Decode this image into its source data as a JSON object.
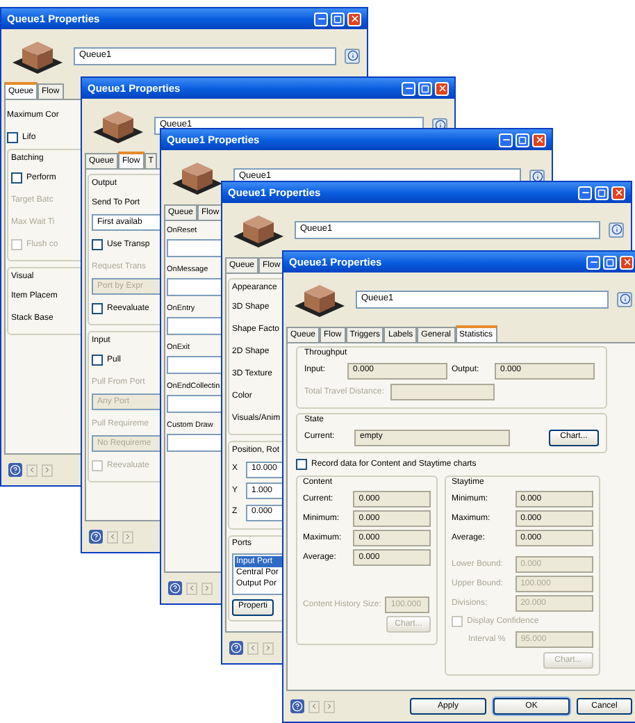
{
  "windows": [
    {
      "title": "Queue1 Properties",
      "name": "Queue1",
      "tabs": [
        {
          "label": "Queue",
          "selected": true
        },
        {
          "label": "Flow",
          "selected": false
        }
      ],
      "body": {
        "kind": "form",
        "items": [
          {
            "kind": "label",
            "text": "Maximum Cor",
            "disabled": false
          },
          {
            "kind": "checkbox",
            "label": "Lifo",
            "checked": false,
            "disabled": false
          },
          {
            "kind": "group",
            "label": "Batching",
            "children": [
              {
                "kind": "checkbox",
                "label": "Perform",
                "checked": false,
                "disabled": false
              },
              {
                "kind": "label",
                "text": "Target Batc",
                "disabled": true
              },
              {
                "kind": "label",
                "text": "Max Wait Ti",
                "disabled": true
              },
              {
                "kind": "checkbox",
                "label": "Flush co",
                "checked": false,
                "disabled": true
              }
            ]
          },
          {
            "kind": "group",
            "label": "Visual",
            "children": [
              {
                "kind": "label",
                "text": "Item Placem",
                "disabled": false
              },
              {
                "kind": "label",
                "text": "Stack Base",
                "disabled": false
              }
            ]
          }
        ]
      }
    },
    {
      "title": "Queue1 Properties",
      "name": "Queue1",
      "tabs": [
        {
          "label": "Queue",
          "selected": false
        },
        {
          "label": "Flow",
          "selected": true
        },
        {
          "label": "T",
          "selected": false
        }
      ],
      "body": {
        "kind": "form",
        "items": [
          {
            "kind": "group",
            "label": "Output",
            "children": [
              {
                "kind": "label",
                "text": "Send To Port",
                "disabled": false
              },
              {
                "kind": "dropdown",
                "value": "First availab",
                "disabled": false
              },
              {
                "kind": "checkbox",
                "label": "Use Transp",
                "checked": false,
                "disabled": false
              },
              {
                "kind": "label",
                "text": "Request Trans",
                "disabled": true
              },
              {
                "kind": "dropdown",
                "value": "Port by Expr",
                "disabled": true
              },
              {
                "kind": "checkbox",
                "label": "Reevaluate",
                "checked": false,
                "disabled": false
              }
            ]
          },
          {
            "kind": "group",
            "label": "Input",
            "children": [
              {
                "kind": "checkbox",
                "label": "Pull",
                "checked": false,
                "disabled": false
              },
              {
                "kind": "label",
                "text": "Pull From Port",
                "disabled": true
              },
              {
                "kind": "dropdown",
                "value": "Any Port",
                "disabled": true
              },
              {
                "kind": "label",
                "text": "Pull Requireme",
                "disabled": true
              },
              {
                "kind": "dropdown",
                "value": "No Requireme",
                "disabled": true
              },
              {
                "kind": "checkbox",
                "label": "Reevaluate",
                "checked": false,
                "disabled": true
              }
            ]
          }
        ]
      }
    },
    {
      "title": "Queue1 Properties",
      "name": "Queue1",
      "tabs": [
        {
          "label": "Queue",
          "selected": false
        },
        {
          "label": "Flow",
          "selected": false
        }
      ],
      "body": {
        "kind": "form",
        "items": [
          {
            "kind": "code_field",
            "label": "OnReset"
          },
          {
            "kind": "code_field",
            "label": "OnMessage"
          },
          {
            "kind": "code_field",
            "label": "OnEntry"
          },
          {
            "kind": "code_field",
            "label": "OnExit"
          },
          {
            "kind": "code_field",
            "label": "OnEndCollectin"
          },
          {
            "kind": "code_field",
            "label": "Custom Draw"
          }
        ]
      }
    },
    {
      "title": "Queue1 Properties",
      "name": "Queue1",
      "tabs": [
        {
          "label": "Queue",
          "selected": false
        },
        {
          "label": "Flow",
          "selected": false
        }
      ],
      "body": {
        "kind": "form",
        "items": [
          {
            "kind": "group",
            "label": "Appearance",
            "children": [
              {
                "kind": "label",
                "text": "3D Shape",
                "disabled": false
              },
              {
                "kind": "label",
                "text": "Shape Facto",
                "disabled": false
              },
              {
                "kind": "label",
                "text": "2D Shape",
                "disabled": false
              },
              {
                "kind": "label",
                "text": "3D Texture",
                "disabled": false
              },
              {
                "kind": "label",
                "text": "Color",
                "disabled": false
              },
              {
                "kind": "label",
                "text": "Visuals/Anim",
                "disabled": false
              }
            ]
          },
          {
            "kind": "group",
            "label": "Position, Rot",
            "children": [
              {
                "kind": "field",
                "label": "X",
                "value": "10.000"
              },
              {
                "kind": "field",
                "label": "Y",
                "value": "1.000"
              },
              {
                "kind": "field",
                "label": "Z",
                "value": "0.000"
              }
            ]
          },
          {
            "kind": "group",
            "label": "Ports",
            "children": [
              {
                "kind": "list",
                "options": [
                  {
                    "text": "Input Port",
                    "selected": true
                  },
                  {
                    "text": "Central Por",
                    "selected": false
                  },
                  {
                    "text": "Output Por",
                    "selected": false
                  }
                ]
              },
              {
                "kind": "button",
                "label": "Properti",
                "disabled": false
              }
            ]
          }
        ]
      }
    },
    {
      "title": "Queue1 Properties",
      "name": "Queue1",
      "tabs": [
        {
          "label": "Queue",
          "selected": false
        },
        {
          "label": "Flow",
          "selected": false
        },
        {
          "label": "Triggers",
          "selected": false
        },
        {
          "label": "Labels",
          "selected": false
        },
        {
          "label": "General",
          "selected": false
        },
        {
          "label": "Statistics",
          "selected": true
        }
      ],
      "body": {
        "kind": "statistics",
        "throughput": {
          "label": "Throughput",
          "rows": [
            {
              "label": "Input:",
              "value": "0.000",
              "disabled": false
            },
            {
              "label": "Output:",
              "value": "0.000",
              "disabled": false
            }
          ],
          "distance": {
            "label": "Total Travel Distance:",
            "disabled": true
          }
        },
        "state": {
          "label": "State",
          "current_label": "Current:",
          "current": "empty",
          "chart": {
            "label": "Chart...",
            "disabled": false
          }
        },
        "record": {
          "label": "Record data for Content and Staytime charts",
          "checked": false
        },
        "content": {
          "label": "Content",
          "rows": [
            {
              "label": "Current:",
              "value": "0.000",
              "disabled": false
            },
            {
              "label": "Minimum:",
              "value": "0.000",
              "disabled": false
            },
            {
              "label": "Maximum:",
              "value": "0.000",
              "disabled": false
            },
            {
              "label": "Average:",
              "value": "0.000",
              "disabled": false
            }
          ],
          "history": {
            "label": "Content History Size:",
            "value": "100.000",
            "disabled": true
          },
          "chart": {
            "label": "Chart...",
            "disabled": true
          }
        },
        "staytime": {
          "label": "Staytime",
          "rows": [
            {
              "label": "Minimum:",
              "value": "0.000",
              "disabled": false
            },
            {
              "label": "Maximum:",
              "value": "0.000",
              "disabled": false
            },
            {
              "label": "Average:",
              "value": "0.000",
              "disabled": false
            },
            {
              "label": "Lower Bound:",
              "value": "0.000",
              "disabled": true
            },
            {
              "label": "Upper Bound:",
              "value": "100.000",
              "disabled": true
            },
            {
              "label": "Divisions:",
              "value": "20.000",
              "disabled": true
            }
          ],
          "confidence": {
            "label": "Display Confidence",
            "checked": false,
            "disabled": true
          },
          "interval": {
            "label": "Interval %",
            "value": "95.000",
            "disabled": true
          },
          "chart": {
            "label": "Chart...",
            "disabled": true
          }
        }
      },
      "buttons": [
        {
          "label": "Apply",
          "default": false
        },
        {
          "label": "OK",
          "default": true
        },
        {
          "label": "Cancel",
          "default": false
        }
      ]
    }
  ]
}
